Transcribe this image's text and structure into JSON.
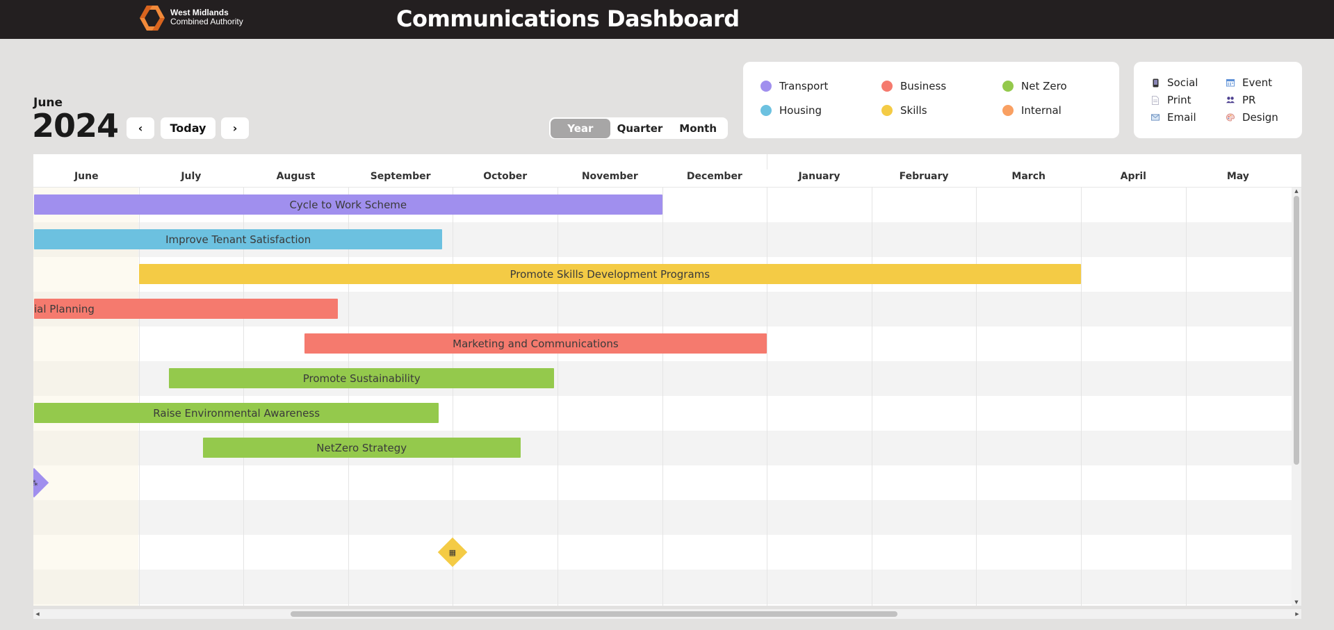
{
  "header": {
    "logo_line1": "West Midlands",
    "logo_line2": "Combined Authority",
    "title": "Communications Dashboard"
  },
  "date": {
    "month": "June",
    "year": "2024"
  },
  "nav": {
    "prev": "‹",
    "today": "Today",
    "next": "›"
  },
  "view_toggle": {
    "options": [
      "Year",
      "Quarter",
      "Month"
    ],
    "active": "Year"
  },
  "categories": [
    {
      "label": "Transport",
      "color": "#a08fee"
    },
    {
      "label": "Business",
      "color": "#f57a6e"
    },
    {
      "label": "Net Zero",
      "color": "#94c94c"
    },
    {
      "label": "Housing",
      "color": "#6cc1e0"
    },
    {
      "label": "Skills",
      "color": "#f4cb45"
    },
    {
      "label": "Internal",
      "color": "#f9a062"
    }
  ],
  "types": [
    {
      "label": "Social",
      "icon": "phone-icon"
    },
    {
      "label": "Event",
      "icon": "calendar-icon"
    },
    {
      "label": "Print",
      "icon": "document-icon"
    },
    {
      "label": "PR",
      "icon": "people-icon"
    },
    {
      "label": "Email",
      "icon": "envelope-icon"
    },
    {
      "label": "Design",
      "icon": "palette-icon"
    }
  ],
  "timeline": {
    "months": [
      "June",
      "July",
      "August",
      "September",
      "October",
      "November",
      "December",
      "January",
      "February",
      "March",
      "April",
      "May"
    ],
    "bars": [
      {
        "label": "Cycle to Work Scheme",
        "category": "Transport",
        "start": "2024-06-01",
        "end": "2024-11-30"
      },
      {
        "label": "Improve Tenant Satisfaction",
        "category": "Housing",
        "start": "2024-06-01",
        "end": "2024-09-27"
      },
      {
        "label": "Promote Skills Development Programs",
        "category": "Skills",
        "start": "2024-07-01",
        "end": "2025-03-31"
      },
      {
        "label": "ial Planning",
        "category": "Business",
        "start": "2024-06-01",
        "end": "2024-08-28"
      },
      {
        "label": "Marketing and Communications",
        "category": "Business",
        "start": "2024-08-19",
        "end": "2024-12-31"
      },
      {
        "label": "Promote Sustainability",
        "category": "Net Zero",
        "start": "2024-07-10",
        "end": "2024-10-30"
      },
      {
        "label": "Raise Environmental Awareness",
        "category": "Net Zero",
        "start": "2024-06-01",
        "end": "2024-09-26"
      },
      {
        "label": "NetZero Strategy",
        "category": "Net Zero",
        "start": "2024-07-20",
        "end": "2024-10-20"
      }
    ],
    "milestones": [
      {
        "category": "Transport",
        "icon": "people-icon",
        "glyph": "⁂",
        "date": "2024-06-01"
      },
      {
        "category": "Skills",
        "icon": "calendar-icon",
        "glyph": "▦",
        "date": "2024-10-01"
      }
    ]
  }
}
